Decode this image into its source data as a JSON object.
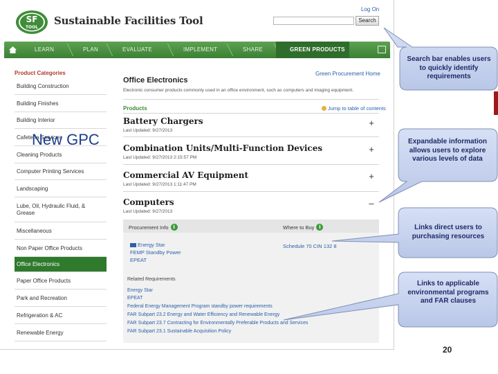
{
  "header": {
    "site_title": "Sustainable Facilities Tool",
    "logo_text_top": "SF",
    "logo_text_bottom": "TOOL",
    "login_label": "Log On",
    "search_placeholder": "",
    "search_button": "Search"
  },
  "nav": {
    "items": [
      {
        "label": "LEARN"
      },
      {
        "label": "PLAN"
      },
      {
        "label": "EVALUATE"
      },
      {
        "label": "IMPLEMENT"
      },
      {
        "label": "SHARE"
      },
      {
        "label": "GREEN PRODUCTS"
      }
    ]
  },
  "sidebar": {
    "title": "Product Categories",
    "items": [
      {
        "label": "Building Construction",
        "active": false
      },
      {
        "label": "Building Finishes",
        "active": false
      },
      {
        "label": "Building Interior",
        "active": false
      },
      {
        "label": "Cafeteria Services",
        "active": false
      },
      {
        "label": "Cleaning Products",
        "active": false
      },
      {
        "label": "Computer Printing Services",
        "active": false
      },
      {
        "label": "Landscaping",
        "active": false
      },
      {
        "label": "Lube, Oil, Hydraulic Fluid, & Grease",
        "active": false
      },
      {
        "label": "Miscellaneous",
        "active": false
      },
      {
        "label": "Non Paper Office Products",
        "active": false
      },
      {
        "label": "Office Electronics",
        "active": true
      },
      {
        "label": "Paper Office Products",
        "active": false
      },
      {
        "label": "Park and Recreation",
        "active": false
      },
      {
        "label": "Refrigeration & AC",
        "active": false
      },
      {
        "label": "Renewable Energy",
        "active": false
      }
    ]
  },
  "main": {
    "top_link": "Green Procurement Home",
    "title": "Office Electronics",
    "description": "Electronic consumer products commonly used in an office environment, such as computers and imaging equipment.",
    "products_label": "Products",
    "jump_link": "Jump to table of contents",
    "products": [
      {
        "title": "Battery Chargers",
        "date": "Last Updated: 9/27/2013",
        "toggle": "+"
      },
      {
        "title": "Combination Units/Multi-Function Devices",
        "date": "Last Updated: 9/27/2013 2:15:57 PM",
        "toggle": "+"
      },
      {
        "title": "Commercial AV Equipment",
        "date": "Last Updated: 9/27/2013 1:11:47 PM",
        "toggle": "+"
      },
      {
        "title": "Computers",
        "date": "Last Updated: 9/27/2013",
        "toggle": "–"
      }
    ],
    "expanded": {
      "procurement_label": "Procurement Info",
      "where_label": "Where to Buy",
      "procurement_links": [
        "Energy Star",
        "FEMP Standby Power",
        "EPEAT"
      ],
      "where_link": "Schedule 70 CIN 132 8",
      "related_label": "Related Requirements",
      "related_links": [
        "Energy Star",
        "EPEAT",
        "Federal Energy Management Program standby power requirements",
        "FAR Subpart 23.2 Energy and Water Efficiency and Renewable Energy",
        "FAR Subpart 23.7 Contracting for Environmentally Preferable Products and Services",
        "FAR Subpart 23.1 Sustainable Acquisition Policy"
      ]
    }
  },
  "overlay_label": "New GPC",
  "callouts": [
    {
      "text": "Search bar enables users to quickly identify requirements"
    },
    {
      "text": "Expandable information allows users to explore various levels of data"
    },
    {
      "text": "Links direct users to purchasing resources"
    },
    {
      "text": "Links to applicable environmental programs and FAR clauses"
    }
  ],
  "page_number": "20",
  "colors": {
    "nav_green": "#4a9142",
    "active_green": "#2f7a2c",
    "callout_fill": "#c7d3ef",
    "callout_text": "#1f2a66",
    "link_blue": "#2b60a8"
  }
}
